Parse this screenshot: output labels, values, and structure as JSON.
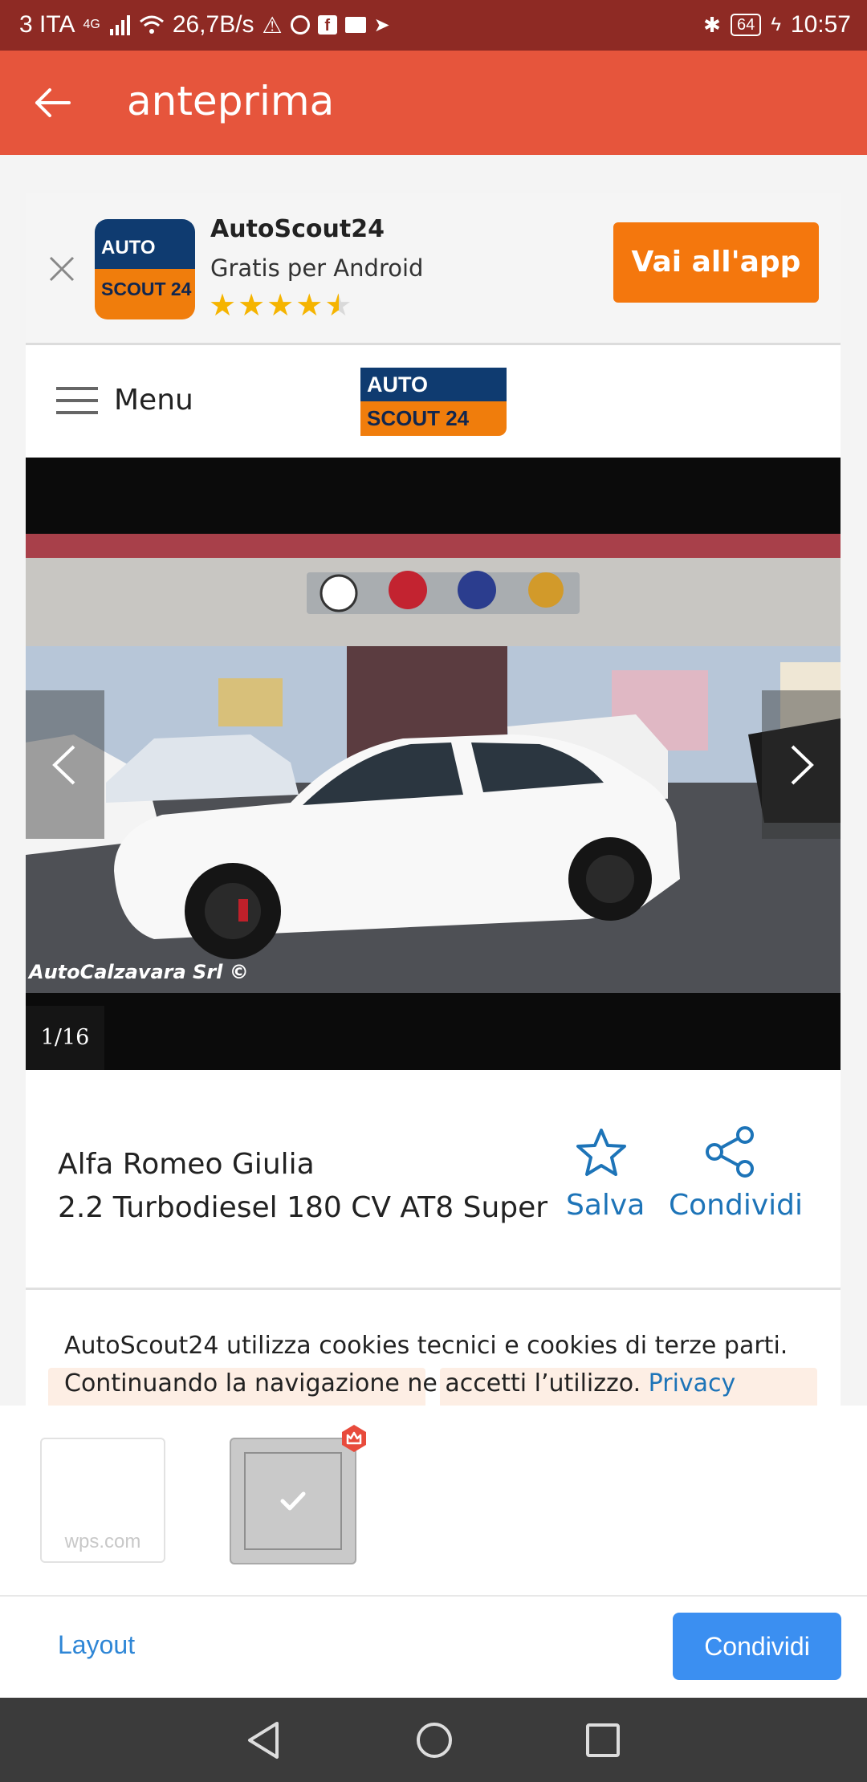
{
  "status_bar": {
    "carrier": "3 ITA",
    "network": "4G",
    "speed": "26,7B/s",
    "battery": "64",
    "time": "10:57"
  },
  "app_bar": {
    "title": "anteprima"
  },
  "banner": {
    "app_name": "AutoScout24",
    "subtitle": "Gratis per Android",
    "rating": 4.5,
    "cta": "Vai all'app",
    "logo_top": "AUTO",
    "logo_bottom": "SCOUT 24"
  },
  "nav": {
    "menu_label": "Menu",
    "logo_top": "AUTO",
    "logo_bottom": "SCOUT 24"
  },
  "gallery": {
    "counter": "1/16",
    "watermark": "AutoCalzavara Srl ©"
  },
  "listing": {
    "title_line1": "Alfa Romeo Giulia",
    "title_line2": "2.2 Turbodiesel 180 CV AT8 Super",
    "save_label": "Salva",
    "share_label": "Condividi"
  },
  "cookie": {
    "line1": "AutoScout24 utilizza cookies tecnici e cookies di terze parti.",
    "line2": "Continuando la navigazione ne accetti l’utilizzo.",
    "link": "Privacy"
  },
  "share_sheet": {
    "thumb1_caption": "wps.com",
    "layout_label": "Layout",
    "share_button": "Condividi"
  },
  "colors": {
    "status_bar": "#8e2a24",
    "app_bar": "#e6553c",
    "cta_orange": "#f4770d",
    "link_blue": "#1d74b8",
    "share_button": "#3b8ff1"
  }
}
